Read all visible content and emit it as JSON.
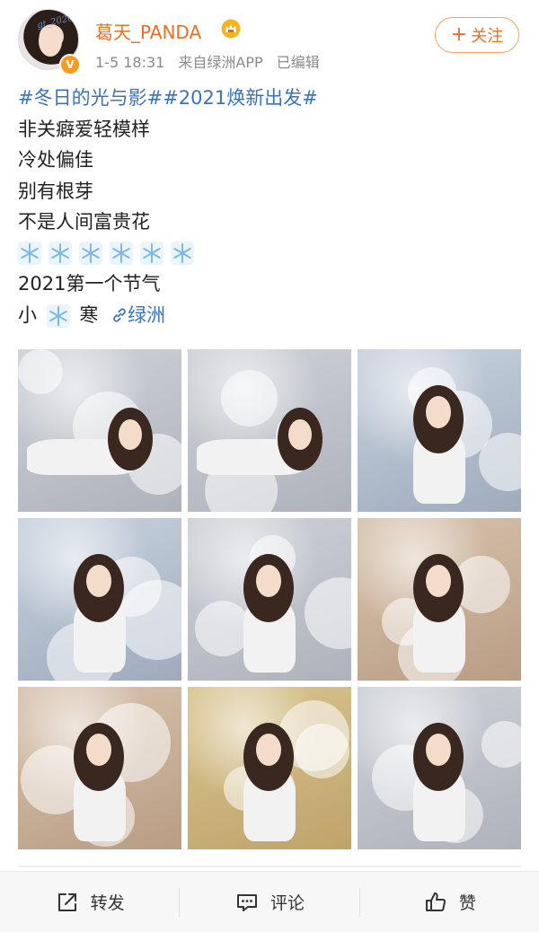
{
  "post": {
    "username": "葛天_PANDA",
    "avatar_tag": "gt_2020",
    "timestamp": "1-5 18:31",
    "source": "来自绿洲APP",
    "edited": "已编辑",
    "follow_label": "关注",
    "hashtags": "#冬日的光与影##2021焕新出发#",
    "lines": [
      "非关癖爱轻模样",
      "冷处偏佳",
      "别有根芽",
      "不是人间富贵花"
    ],
    "snowflake_count": 6,
    "line_2021": "2021第一个节气",
    "xiaohan_prefix": "小",
    "xiaohan_suffix": "寒",
    "link_label": "绿洲"
  },
  "colors": {
    "username": "#f06d20",
    "link": "#3b73b9",
    "meta": "#8a8a8a",
    "badge": "#f79b1e"
  },
  "icons": [
    "verified-v-icon",
    "vip-crown-icon",
    "snowflake-icon",
    "link-icon",
    "share-icon",
    "comment-icon",
    "like-icon"
  ],
  "photos": [
    {
      "tone": "cool-grey",
      "pose": "lying"
    },
    {
      "tone": "cool-grey",
      "pose": "lying"
    },
    {
      "tone": "cool-blue",
      "pose": "standing"
    },
    {
      "tone": "cool-blue",
      "pose": "sitting"
    },
    {
      "tone": "cool-grey",
      "pose": "sitting"
    },
    {
      "tone": "warm-beige",
      "pose": "kneeling"
    },
    {
      "tone": "warm-beige",
      "pose": "sitting"
    },
    {
      "tone": "warm-gold",
      "pose": "standing"
    },
    {
      "tone": "cool-grey",
      "pose": "sitting"
    }
  ],
  "actions": {
    "share": "转发",
    "comment": "评论",
    "like": "赞"
  }
}
